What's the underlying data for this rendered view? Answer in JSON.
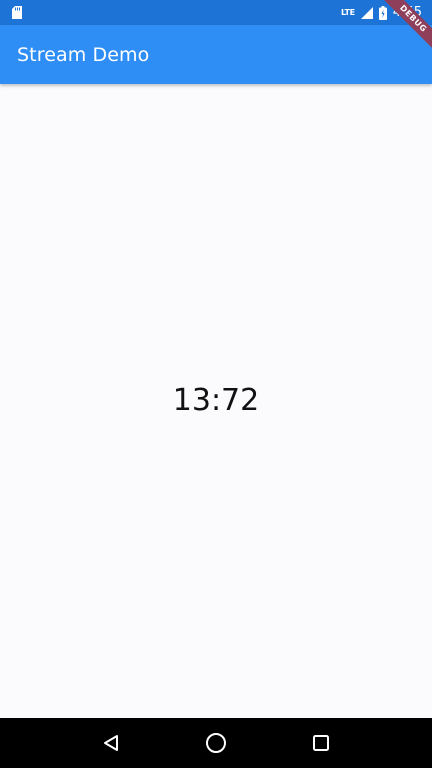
{
  "status_bar": {
    "network_type": "LTE",
    "time": "4:55",
    "icons": [
      "sd-card-icon",
      "lte-icon",
      "signal-icon",
      "battery-icon"
    ]
  },
  "app_bar": {
    "title": "Stream Demo",
    "color": "#2f8ef5"
  },
  "debug_banner": {
    "label": "DEBUG",
    "color": "#8f3f5a"
  },
  "main": {
    "counter_text": "13:72"
  },
  "nav_bar": {
    "buttons": [
      "back-icon",
      "home-icon",
      "recents-icon"
    ]
  }
}
